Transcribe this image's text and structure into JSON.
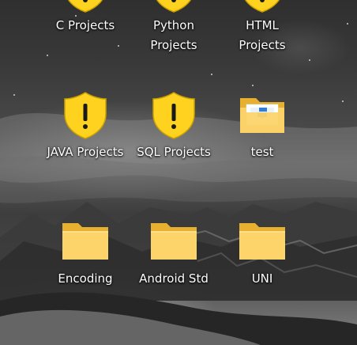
{
  "colors": {
    "shield_fill": "#ffd21f",
    "shield_mark": "#1a1a1a",
    "folder_back": "#e8b02f",
    "folder_front": "#fcd46a",
    "label_text": "#ffffff"
  },
  "desktop": {
    "icons": [
      {
        "id": "c-projects",
        "kind": "shield-icon",
        "label_lines": [
          "C Projects"
        ]
      },
      {
        "id": "python-projects",
        "kind": "shield-icon",
        "label_lines": [
          "Python",
          "Projects"
        ]
      },
      {
        "id": "html-projects",
        "kind": "shield-icon",
        "label_lines": [
          "HTML",
          "Projects"
        ]
      },
      {
        "id": "java-projects",
        "kind": "shield-icon",
        "label_lines": [
          "JAVA Projects"
        ]
      },
      {
        "id": "sql-projects",
        "kind": "shield-icon",
        "label_lines": [
          "SQL Projects"
        ]
      },
      {
        "id": "test",
        "kind": "folder-with-document-icon",
        "label_lines": [
          "test"
        ]
      },
      {
        "id": "encoding",
        "kind": "folder-icon",
        "label_lines": [
          "Encoding"
        ]
      },
      {
        "id": "android-std",
        "kind": "folder-icon",
        "label_lines": [
          "Android Std"
        ]
      },
      {
        "id": "uni",
        "kind": "folder-icon",
        "label_lines": [
          "UNI"
        ]
      }
    ]
  }
}
